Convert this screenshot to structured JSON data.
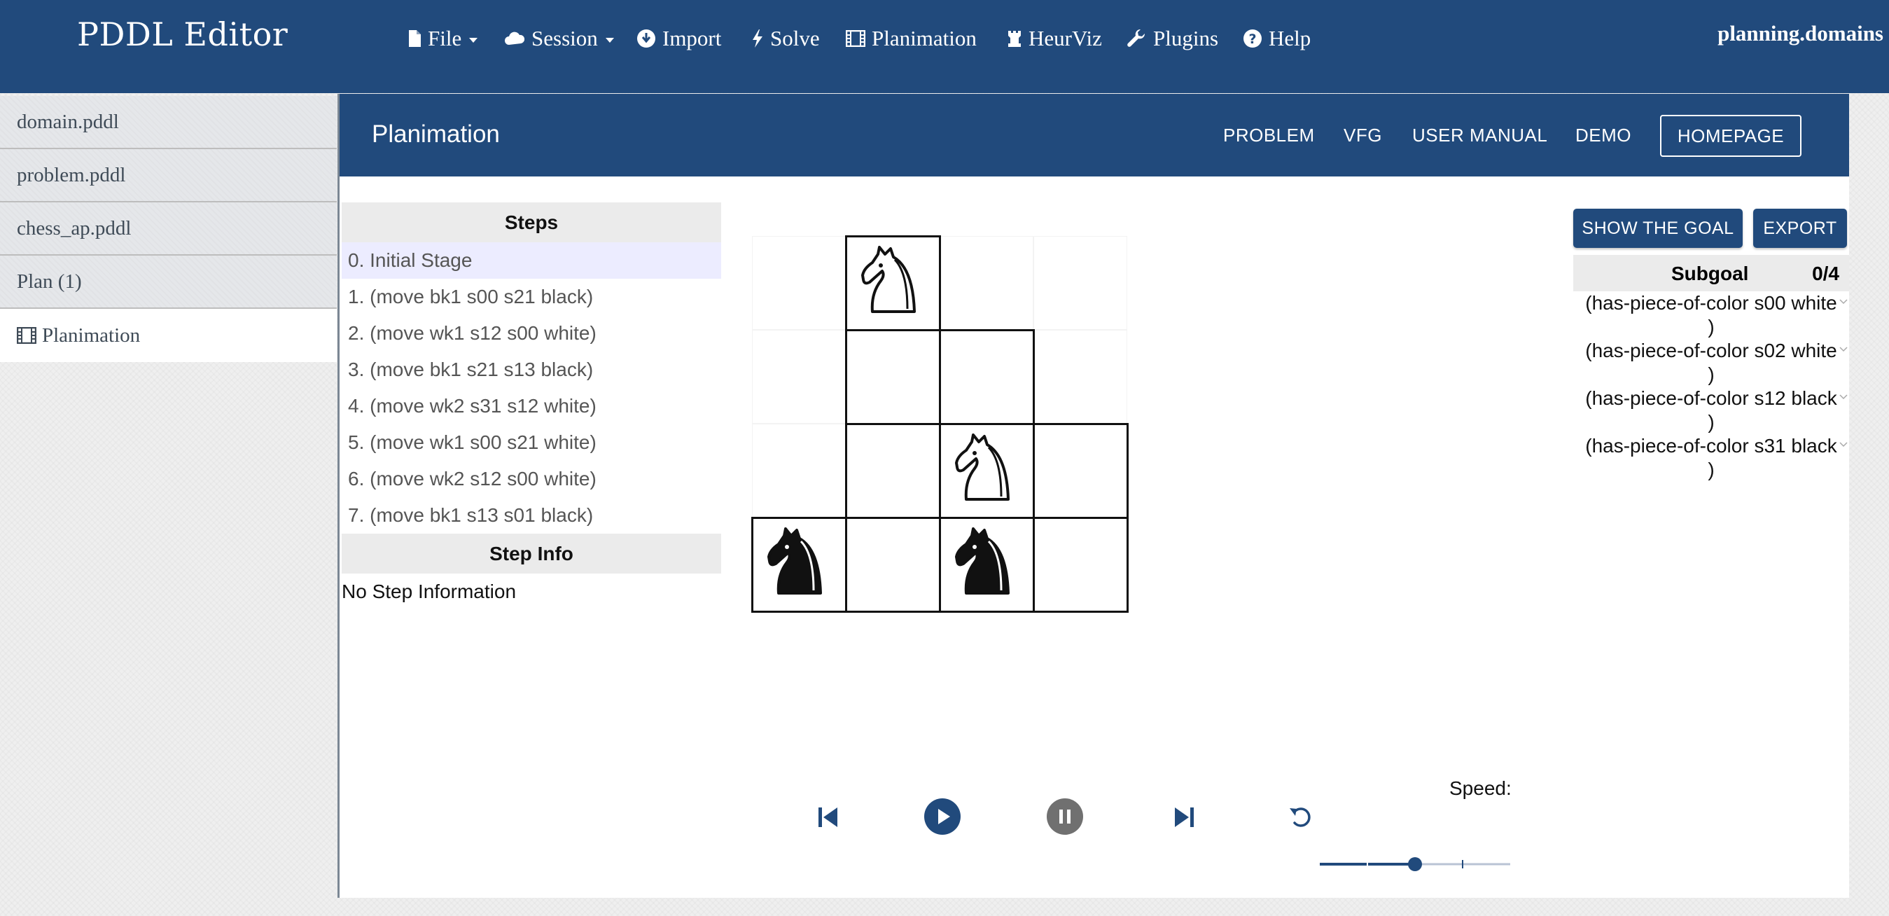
{
  "navbar": {
    "brand": "PDDL Editor",
    "items": [
      {
        "label": "File",
        "icon": "file-icon",
        "dropdown": true
      },
      {
        "label": "Session",
        "icon": "cloud-icon",
        "dropdown": true
      },
      {
        "label": "Import",
        "icon": "download-circle-icon"
      },
      {
        "label": "Solve",
        "icon": "bolt-icon"
      },
      {
        "label": "Planimation",
        "icon": "film-icon"
      },
      {
        "label": "HeurViz",
        "icon": "rook-icon"
      },
      {
        "label": "Plugins",
        "icon": "wrench-icon"
      },
      {
        "label": "Help",
        "icon": "question-circle-icon"
      }
    ],
    "right_link": "planning.domains"
  },
  "file_tabs": [
    {
      "label": "domain.pddl"
    },
    {
      "label": "problem.pddl"
    },
    {
      "label": "chess_ap.pddl"
    },
    {
      "label": "Plan (1)"
    },
    {
      "label": "Planimation",
      "icon": "film-icon",
      "active": true
    }
  ],
  "panel": {
    "title": "Planimation",
    "links": [
      "PROBLEM",
      "VFG",
      "USER MANUAL",
      "DEMO"
    ],
    "homepage": "HOMEPAGE"
  },
  "steps": {
    "header": "Steps",
    "items": [
      "0. Initial Stage",
      "1. (move bk1 s00 s21 black)",
      "2. (move wk1 s12 s00 white)",
      "3. (move bk1 s21 s13 black)",
      "4. (move wk2 s31 s12 white)",
      "5. (move wk1 s00 s21 white)",
      "6. (move wk2 s12 s00 white)",
      "7. (move bk1 s13 s01 black)"
    ],
    "active_index": 0,
    "info_header": "Step Info",
    "info_text": "No Step Information"
  },
  "board": {
    "cells": [
      {
        "row": 0,
        "col": 1,
        "piece": "white-knight"
      },
      {
        "row": 1,
        "col": 1,
        "piece": null
      },
      {
        "row": 1,
        "col": 2,
        "piece": null
      },
      {
        "row": 2,
        "col": 1,
        "piece": null
      },
      {
        "row": 2,
        "col": 2,
        "piece": "white-knight"
      },
      {
        "row": 2,
        "col": 3,
        "piece": null
      },
      {
        "row": 3,
        "col": 0,
        "piece": "black-knight"
      },
      {
        "row": 3,
        "col": 1,
        "piece": null
      },
      {
        "row": 3,
        "col": 2,
        "piece": "black-knight"
      },
      {
        "row": 3,
        "col": 3,
        "piece": null
      }
    ]
  },
  "actions": {
    "show_goal": "SHOW THE GOAL",
    "export": "EXPORT"
  },
  "subgoal": {
    "header": "Subgoal",
    "count": "0/4",
    "items": [
      {
        "line1": "(has-piece-of-color s00 white",
        "line2": ")"
      },
      {
        "line1": "(has-piece-of-color s02 white",
        "line2": ")"
      },
      {
        "line1": "(has-piece-of-color s12 black",
        "line2": ")"
      },
      {
        "line1": "(has-piece-of-color s31 black",
        "line2": ")"
      }
    ]
  },
  "playback": {
    "speed_label": "Speed:",
    "speed_value": 0.5,
    "colors": {
      "accent": "#214a7c",
      "pause": "#707070"
    }
  }
}
